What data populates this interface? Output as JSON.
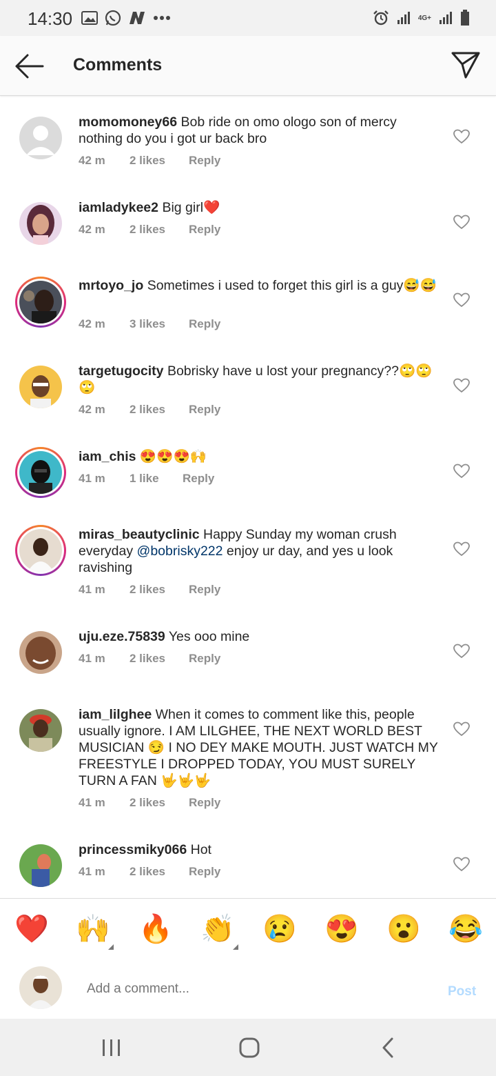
{
  "status_bar": {
    "time": "14:30",
    "network": "4G+",
    "left_icons": [
      "gallery-icon",
      "whatsapp-icon",
      "n-app-icon",
      "more-dots-icon"
    ],
    "right_icons": [
      "alarm-icon",
      "signal-icon",
      "signal-icon",
      "battery-icon"
    ]
  },
  "header": {
    "title": "Comments"
  },
  "comments": [
    {
      "username": "momomoney66",
      "text": "Bob ride on omo ologo son of mercy nothing do you i got ur back bro",
      "time": "42 m",
      "likes": "2 likes",
      "reply": "Reply"
    },
    {
      "username": "iamladykee2",
      "text": "Big girl❤️",
      "time": "42 m",
      "likes": "2 likes",
      "reply": "Reply"
    },
    {
      "username": "mrtoyo_jo",
      "text": "Sometimes i used to forget this girl is a guy😅😅",
      "time": "42 m",
      "likes": "3 likes",
      "reply": "Reply"
    },
    {
      "username": "targetugocity",
      "text": "Bobrisky have u lost your pregnancy??🙄🙄🙄",
      "time": "42 m",
      "likes": "2 likes",
      "reply": "Reply"
    },
    {
      "username": "iam_chis",
      "text": "😍😍😍🙌",
      "time": "41 m",
      "likes": "1 like",
      "reply": "Reply"
    },
    {
      "username": "miras_beautyclinic",
      "text_before": "Happy Sunday my woman crush everyday ",
      "mention": "@bobrisky222",
      "text_after": " enjoy ur day, and yes u look ravishing",
      "time": "41 m",
      "likes": "2 likes",
      "reply": "Reply"
    },
    {
      "username": "uju.eze.75839",
      "text": "Yes ooo mine",
      "time": "41 m",
      "likes": "2 likes",
      "reply": "Reply"
    },
    {
      "username": "iam_lilghee",
      "text": "When it comes to comment like this, people usually ignore. I AM LILGHEE, THE NEXT WORLD BEST MUSICIAN 😏 I NO DEY MAKE MOUTH.  JUST WATCH MY FREESTYLE I DROPPED TODAY, YOU MUST SURELY TURN A FAN 🤟🤟🤟",
      "time": "41 m",
      "likes": "2 likes",
      "reply": "Reply"
    },
    {
      "username": "princessmiky066",
      "text": "Hot",
      "time": "41 m",
      "likes": "2 likes",
      "reply": "Reply"
    }
  ],
  "emoji_bar": [
    "❤️",
    "🙌",
    "🔥",
    "👏",
    "😢",
    "😍",
    "😮",
    "😂"
  ],
  "composer": {
    "placeholder": "Add a comment...",
    "post_label": "Post"
  },
  "colors": {
    "accent_link": "#003569",
    "post_disabled": "#b3dbff",
    "meta_gray": "#8e8e8e"
  }
}
